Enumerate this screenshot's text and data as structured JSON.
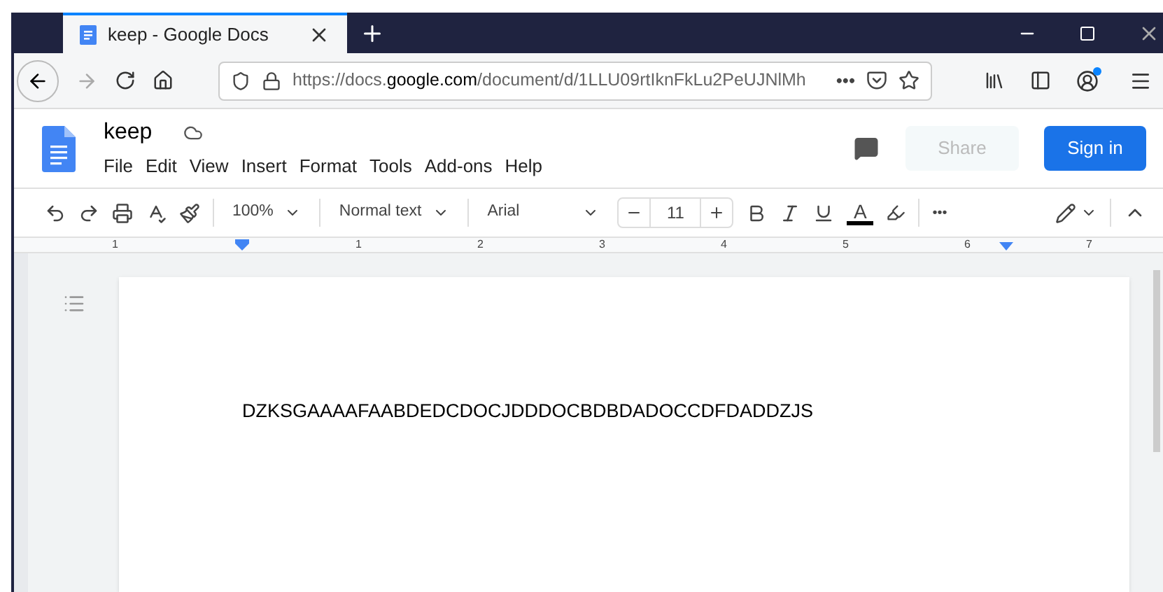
{
  "browser": {
    "tab": {
      "title": "keep - Google Docs",
      "selected": true
    },
    "url": {
      "prefix": "https://docs.",
      "domain": "google.com",
      "path": "/document/d/1LLU09rtIknFkLu2PeUJNlMh"
    },
    "page_actions": "•••",
    "account_notification": true
  },
  "docs": {
    "title": "keep",
    "menu": [
      "File",
      "Edit",
      "View",
      "Insert",
      "Format",
      "Tools",
      "Add-ons",
      "Help"
    ],
    "share": {
      "label": "Share",
      "disabled": true
    },
    "sign_in": "Sign in"
  },
  "toolbar": {
    "zoom": "100%",
    "style": "Normal text",
    "font": "Arial",
    "font_size": "11",
    "more": "•••",
    "text_color": "A"
  },
  "ruler": {
    "left_mark": "1",
    "marks": [
      "1",
      "2",
      "3",
      "4",
      "5",
      "6",
      "7"
    ]
  },
  "document": {
    "text": "DZKSGAAAAFAABDEDCDOCJDDDOCBDBDADOCCDFDADDZJS"
  }
}
